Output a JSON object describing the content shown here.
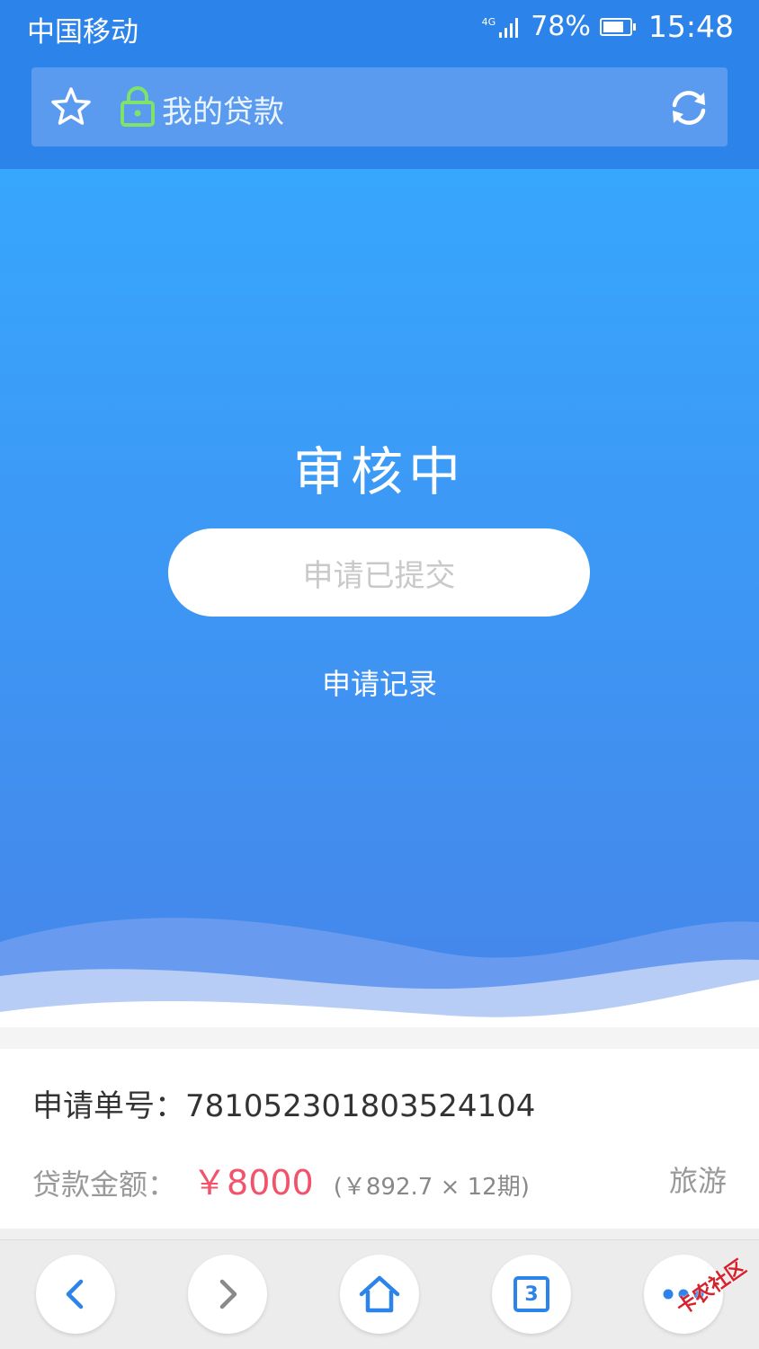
{
  "status_bar": {
    "carrier": "中国移动",
    "network": "4G",
    "battery": "78%",
    "time": "15:48"
  },
  "browser": {
    "url_text": "我的贷款",
    "icons": [
      "star-icon",
      "lock-icon",
      "refresh-icon"
    ]
  },
  "hero": {
    "title": "审核中",
    "status_pill": "申请已提交",
    "record_link": "申请记录"
  },
  "info": {
    "order_label": "申请单号：",
    "order_no": "781052301803524104",
    "amount_label": "贷款金额：",
    "amount_value": "￥8000",
    "installment": "(￥892.7 × 12期)",
    "purpose": "旅游"
  },
  "nav": {
    "tab_count": "3",
    "buttons": [
      "back-icon",
      "forward-icon",
      "home-icon",
      "tabs-icon",
      "more-icon"
    ]
  },
  "watermark": "卡农社区",
  "colors": {
    "primary": "#2c83e9",
    "hero_top": "#37a6fd",
    "amount": "#f2536b",
    "lock": "#7ee36a"
  }
}
